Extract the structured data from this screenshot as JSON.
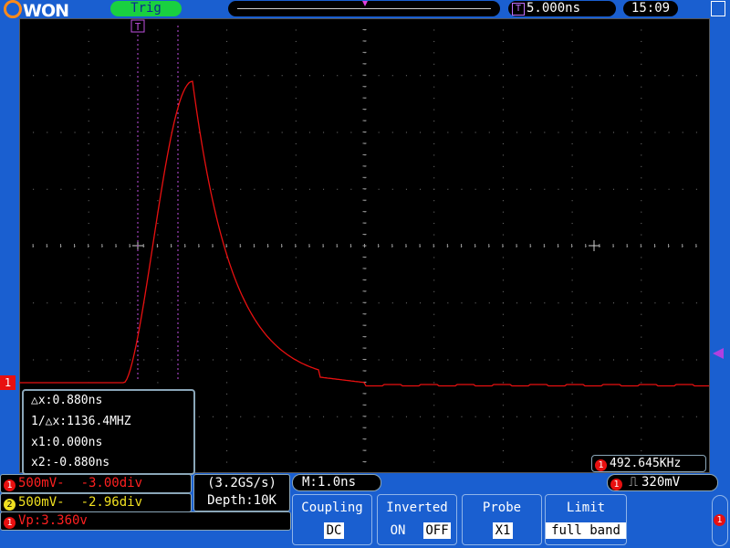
{
  "logo": "OWON",
  "header": {
    "trigger_status": "Trig",
    "timebase_icon": "T",
    "timebase": "5.000ns",
    "clock": "15:09"
  },
  "markers": {
    "ch1": "1",
    "cursor_t": "T"
  },
  "cursor": {
    "dx": "△x:0.880ns",
    "inv_dx": "1/△x:1136.4MHZ",
    "x1": "x1:0.000ns",
    "x2": "x2:-0.880ns"
  },
  "frequency": {
    "channel": "1",
    "value": "492.645KHz"
  },
  "channels": {
    "ch1": {
      "badge": "1",
      "scale": "500mV-",
      "offset": "-3.00div"
    },
    "ch2": {
      "badge": "2",
      "scale": "500mV-",
      "offset": "-2.96div"
    }
  },
  "measure": {
    "badge": "1",
    "text": "Vp:3.360v"
  },
  "sampling": {
    "rate": "(3.2GS/s)",
    "depth": "Depth:10K"
  },
  "memory": "M:1.0ns",
  "trigger": {
    "badge": "1",
    "level": "320mV"
  },
  "menu": {
    "coupling": {
      "title": "Coupling",
      "value": "DC"
    },
    "inverted": {
      "title": "Inverted",
      "on": "ON",
      "off": "OFF"
    },
    "probe": {
      "title": "Probe",
      "value": "X1"
    },
    "limit": {
      "title": "Limit",
      "value": "full band"
    },
    "side_badge": "1"
  },
  "colors": {
    "background": "#1a5fd0",
    "trace_ch1": "#e81010",
    "ch2": "#f0e020",
    "trigger_green": "#19d040",
    "cursor_magenta": "#b040e0"
  }
}
